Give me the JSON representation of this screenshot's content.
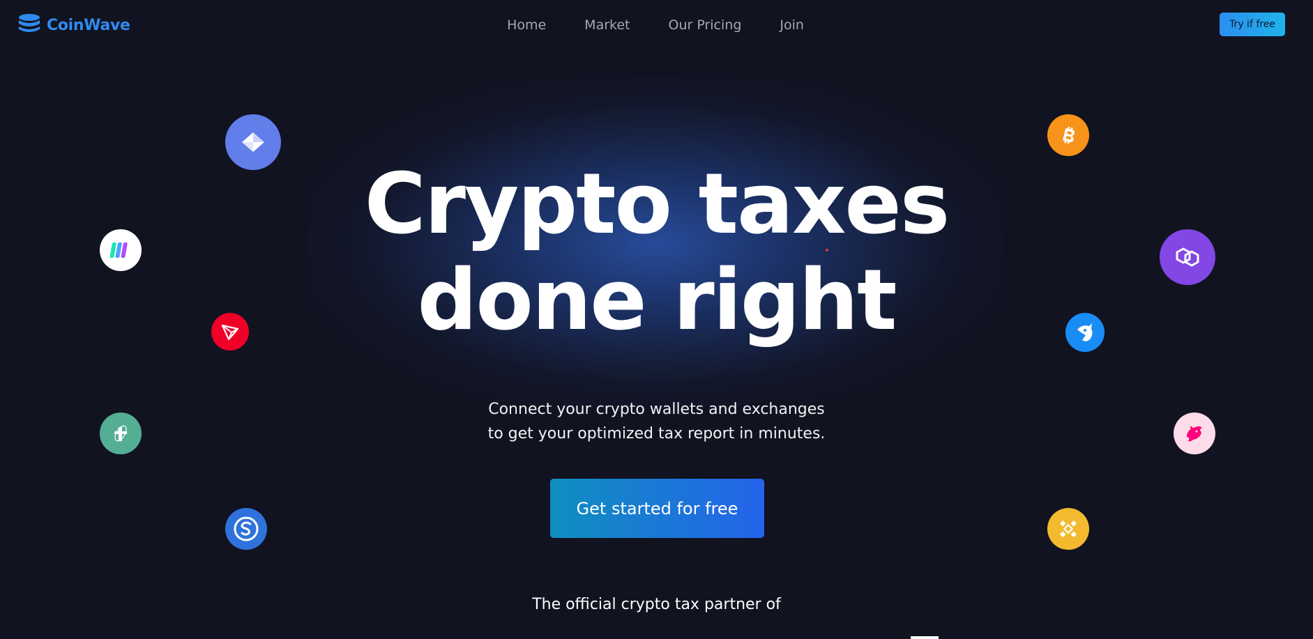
{
  "header": {
    "brand_name": "CoinWave",
    "brand_color": "#2f8bf0",
    "nav": [
      "Home",
      "Market",
      "Our Pricing",
      "Join"
    ],
    "try_button": "Try if free"
  },
  "hero": {
    "title_line1": "Crypto taxes",
    "title_line2": "done right",
    "subtitle_line1": "Connect your crypto wallets and exchanges",
    "subtitle_line2": "to get your optimized tax report in minutes.",
    "cta": "Get started for free",
    "partner_text": "The official crypto tax partner of"
  },
  "coins": [
    {
      "name": "ethereum-icon",
      "color": "#627eea"
    },
    {
      "name": "bitcoin-icon",
      "color": "#f7931a"
    },
    {
      "name": "solana-icon",
      "color": "#ffffff"
    },
    {
      "name": "polygon-icon",
      "color": "#8247e5"
    },
    {
      "name": "tron-icon",
      "color": "#ef0027"
    },
    {
      "name": "pancake-bunny-icon",
      "color": "#1a8cf5"
    },
    {
      "name": "tether-icon",
      "color": "#53ae94"
    },
    {
      "name": "uniswap-icon",
      "color": "#fcdce9"
    },
    {
      "name": "swap-coin-icon",
      "color": "#2f72dc"
    },
    {
      "name": "binance-icon",
      "color": "#f3ba2f"
    }
  ]
}
